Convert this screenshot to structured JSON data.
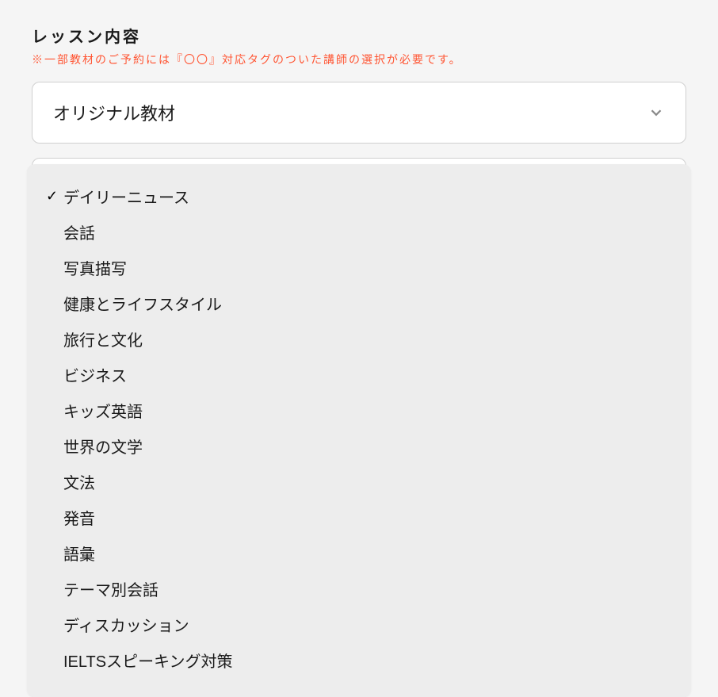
{
  "section": {
    "label": "レッスン内容",
    "notice": "※一部教材のご予約には『〇〇』対応タグのついた講師の選択が必要です。"
  },
  "materialSelect": {
    "value": "オリジナル教材"
  },
  "categoryDropdown": {
    "selectedIndex": 0,
    "options": [
      "デイリーニュース",
      "会話",
      "写真描写",
      "健康とライフスタイル",
      "旅行と文化",
      "ビジネス",
      "キッズ英語",
      "世界の文学",
      "文法",
      "発音",
      "語彙",
      "テーマ別会話",
      "ディスカッション",
      "IELTSスピーキング対策"
    ]
  }
}
